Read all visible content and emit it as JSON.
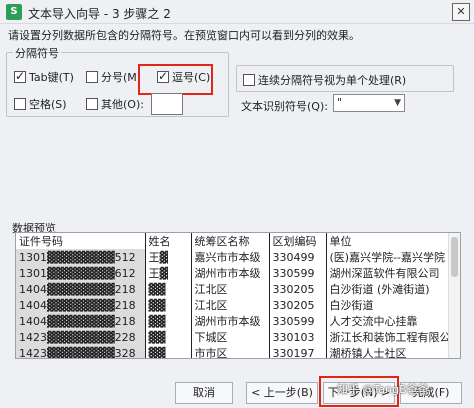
{
  "window": {
    "title": "文本导入向导 - 3 步骤之 2",
    "close_glyph": "✕"
  },
  "instruction": "请设置分列数据所包含的分隔符号。在预览窗口内可以看到分列的效果。",
  "delimiters": {
    "group_title": "分隔符号",
    "tab": {
      "label": "Tab键(T)",
      "checked": true
    },
    "semicolon": {
      "label": "分号(M)",
      "checked": false
    },
    "comma": {
      "label": "逗号(C)",
      "checked": true
    },
    "space": {
      "label": "空格(S)",
      "checked": false
    },
    "other": {
      "label": "其他(O):",
      "checked": false,
      "value": ""
    }
  },
  "consecutive": {
    "label": "连续分隔符号视为单个处理(R)",
    "checked": false
  },
  "text_qualifier": {
    "label": "文本识别符号(Q):",
    "value": "\""
  },
  "preview": {
    "label": "数据预览",
    "headers": [
      "证件号码",
      "姓名",
      "统筹区名称",
      "区划编码",
      "单位"
    ],
    "rows": [
      [
        "1301▓▓▓▓▓▓▓▓512",
        "王▓",
        "嘉兴市市本级",
        "330499",
        "(医)嘉兴学院--嘉兴学院"
      ],
      [
        "1301▓▓▓▓▓▓▓▓612",
        "王▓",
        "湖州市市本级",
        "330599",
        "湖州深蓝软件有限公司"
      ],
      [
        "1404▓▓▓▓▓▓▓▓218",
        "▓▓",
        "江北区",
        "330205",
        "白沙街道 (外滩街道)"
      ],
      [
        "1404▓▓▓▓▓▓▓▓218",
        "▓▓",
        "江北区",
        "330205",
        "白沙街道"
      ],
      [
        "1404▓▓▓▓▓▓▓▓218",
        "▓▓",
        "湖州市市本级",
        "330599",
        "人才交流中心挂靠"
      ],
      [
        "1423▓▓▓▓▓▓▓▓228",
        "▓▓",
        "下城区",
        "330103",
        "浙江长和装饰工程有限公"
      ],
      [
        "1423▓▓▓▓▓▓▓▓328",
        "▓▓",
        "市市区",
        "330197",
        "潮桥镇人士社区"
      ]
    ]
  },
  "buttons": {
    "cancel": "取消",
    "back": "< 上一步(B)",
    "next": "下一步(N) >",
    "finish": "完成(F)"
  },
  "watermark": "知乎 @TangB爸爸",
  "colors": {
    "highlight": "#e0261b",
    "app_icon": "#2f9d5a"
  },
  "icons": {
    "app": "wps-spreadsheet-icon",
    "close": "close-icon"
  }
}
